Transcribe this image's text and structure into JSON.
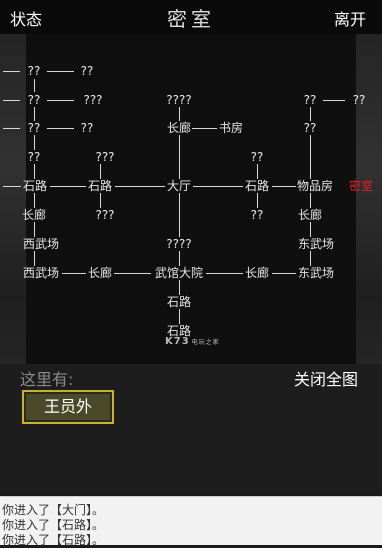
{
  "header": {
    "status_label": "状态",
    "title": "密室",
    "leave_label": "离开"
  },
  "map": {
    "nodes": [
      {
        "id": "r1a",
        "text": "??"
      },
      {
        "id": "r1b",
        "text": "??"
      },
      {
        "id": "r2a",
        "text": "??"
      },
      {
        "id": "r2b",
        "text": "???"
      },
      {
        "id": "r2c",
        "text": "????"
      },
      {
        "id": "r2d",
        "text": "??"
      },
      {
        "id": "r2e",
        "text": "??"
      },
      {
        "id": "r3a",
        "text": "??"
      },
      {
        "id": "r3b",
        "text": "??"
      },
      {
        "id": "r3c",
        "text": "长廊"
      },
      {
        "id": "r3d",
        "text": "书房"
      },
      {
        "id": "r3e",
        "text": "??"
      },
      {
        "id": "r4a",
        "text": "??"
      },
      {
        "id": "r4b",
        "text": "???"
      },
      {
        "id": "r4c",
        "text": "??"
      },
      {
        "id": "r5a",
        "text": "石路"
      },
      {
        "id": "r5b",
        "text": "石路"
      },
      {
        "id": "r5c",
        "text": "大厅"
      },
      {
        "id": "r5d",
        "text": "石路"
      },
      {
        "id": "r5e",
        "text": "物品房"
      },
      {
        "id": "r5f",
        "text": "密室"
      },
      {
        "id": "r6a",
        "text": "长廊"
      },
      {
        "id": "r6b",
        "text": "???"
      },
      {
        "id": "r6c",
        "text": "??"
      },
      {
        "id": "r6d",
        "text": "长廊"
      },
      {
        "id": "r7a",
        "text": "西武场"
      },
      {
        "id": "r7b",
        "text": "????"
      },
      {
        "id": "r7c",
        "text": "东武场"
      },
      {
        "id": "r8a",
        "text": "西武场"
      },
      {
        "id": "r8b",
        "text": "长廊"
      },
      {
        "id": "r8c",
        "text": "武馆大院"
      },
      {
        "id": "r8d",
        "text": "长廊"
      },
      {
        "id": "r8e",
        "text": "东武场"
      },
      {
        "id": "r9a",
        "text": "石路"
      },
      {
        "id": "r10a",
        "text": "石路"
      }
    ]
  },
  "watermark": {
    "main": "K73",
    "sub": "电玩之家"
  },
  "panel": {
    "here_label": "这里有:",
    "close_map_label": "关闭全图",
    "npc_label": "王员外"
  },
  "log": {
    "lines": [
      "你进入了【大门】。",
      "你进入了【石路】。",
      "你进入了【石路】。"
    ]
  },
  "colors": {
    "current_room": "#e02222",
    "npc_border": "#c8b030",
    "background": "#1b1b1b"
  }
}
